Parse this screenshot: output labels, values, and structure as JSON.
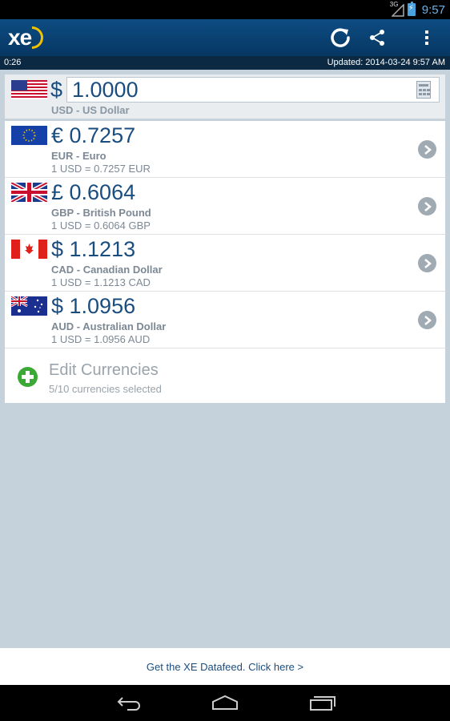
{
  "status": {
    "network": "3G",
    "time": "9:57"
  },
  "header": {
    "logo_text": "xe",
    "refresh_icon": "refresh-icon",
    "share_icon": "share-icon",
    "menu_icon": "overflow-menu-icon"
  },
  "info": {
    "timer": "0:26",
    "updated": "Updated:  2014-03-24 9:57 AM"
  },
  "base": {
    "symbol": "$",
    "amount": "1.0000",
    "code_name": "USD - US Dollar",
    "flag": "us-flag-icon"
  },
  "rows": [
    {
      "big": "€ 0.7257",
      "name": "EUR - Euro",
      "rate": "1 USD = 0.7257 EUR",
      "flag": "eu-flag-icon"
    },
    {
      "big": "£ 0.6064",
      "name": "GBP - British Pound",
      "rate": "1 USD = 0.6064 GBP",
      "flag": "uk-flag-icon"
    },
    {
      "big": "$ 1.1213",
      "name": "CAD - Canadian Dollar",
      "rate": "1 USD = 1.1213 CAD",
      "flag": "ca-flag-icon"
    },
    {
      "big": "$ 1.0956",
      "name": "AUD - Australian Dollar",
      "rate": "1 USD = 1.0956 AUD",
      "flag": "au-flag-icon"
    }
  ],
  "edit": {
    "title": "Edit Currencies",
    "sub": "5/10 currencies selected"
  },
  "footer": {
    "link": "Get the XE Datafeed. Click here >"
  },
  "colors": {
    "appbar": "#0d4c82",
    "accent_text": "#1a4d7f",
    "background": "#c5d2dc",
    "plus": "#3aa935"
  }
}
